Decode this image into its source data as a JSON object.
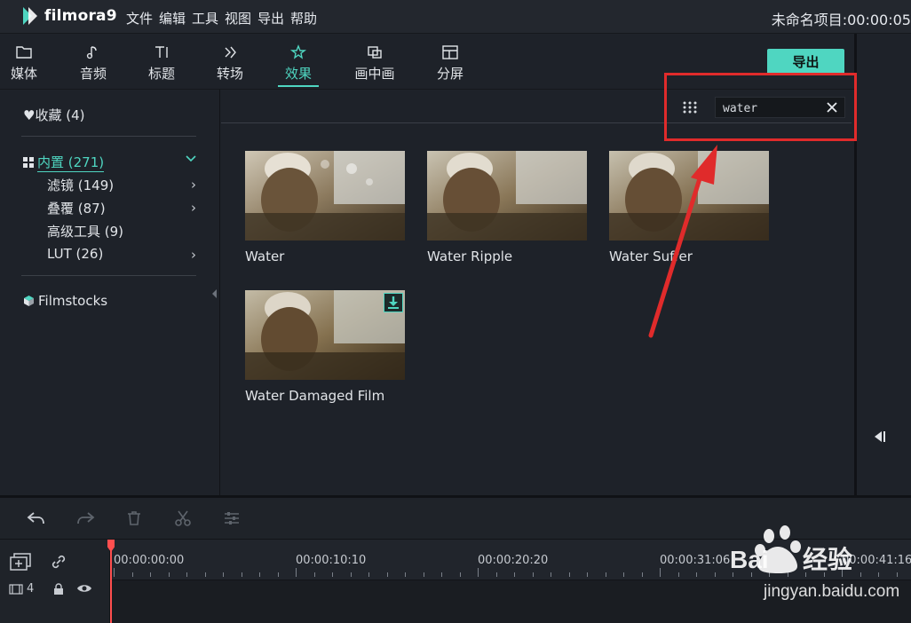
{
  "app": {
    "name": "filmora9",
    "project_title": "未命名项目:00:00:05"
  },
  "menu": [
    "文件",
    "编辑",
    "工具",
    "视图",
    "导出",
    "帮助"
  ],
  "tabs": [
    {
      "label": "媒体",
      "icon": "folder-icon"
    },
    {
      "label": "音频",
      "icon": "music-note-icon"
    },
    {
      "label": "标题",
      "icon": "text-icon"
    },
    {
      "label": "转场",
      "icon": "transition-icon"
    },
    {
      "label": "效果",
      "icon": "effects-icon",
      "active": true
    },
    {
      "label": "画中画",
      "icon": "pip-icon"
    },
    {
      "label": "分屏",
      "icon": "split-screen-icon"
    }
  ],
  "export_label": "导出",
  "sidebar": {
    "favorites": "收藏 (4)",
    "builtin": "内置 (271)",
    "categories": [
      {
        "label": "滤镜 (149)",
        "has_arrow": true
      },
      {
        "label": "叠覆 (87)",
        "has_arrow": true
      },
      {
        "label": "高级工具 (9)",
        "has_arrow": false
      },
      {
        "label": "LUT (26)",
        "has_arrow": true
      }
    ],
    "filmstocks": "Filmstocks"
  },
  "search": {
    "value": "water",
    "placeholder": ""
  },
  "effects": [
    {
      "label": "Water",
      "download": false
    },
    {
      "label": "Water Ripple",
      "download": false
    },
    {
      "label": "Water Suffer",
      "download": false
    },
    {
      "label": "Water Damaged Film",
      "download": true
    }
  ],
  "timeline": {
    "track_count": "4",
    "time_labels": [
      "00:00:00:00",
      "00:00:10:10",
      "00:00:20:20",
      "00:00:31:06",
      "00:00:41:16"
    ]
  },
  "watermark": {
    "text": "jingyan.baidu.com",
    "brand": "Bai du 经验"
  },
  "colors": {
    "accent": "#4fd6c1",
    "highlight": "#e02b2b",
    "playhead": "#ff4f4f"
  }
}
